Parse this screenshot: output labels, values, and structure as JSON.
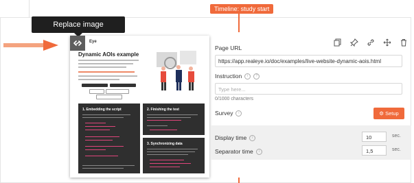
{
  "timeline_badge": "Timeline: study start",
  "replace_tooltip": "Replace image",
  "thumbnail": {
    "brand": "Eye",
    "title": "Dynamic AOIs example",
    "section1": "1. Embedding the script",
    "section2": "2. Finishing the test",
    "section3": "3. Synchronizing data"
  },
  "form": {
    "page_url_label": "Page URL",
    "page_url_value": "https://app.realeye.io/doc/examples/live-website-dynamic-aois.html",
    "instruction_label": "Instruction",
    "instruction_placeholder": "Type here...",
    "char_counter": "0/1000 characters",
    "survey_label": "Survey",
    "setup_button": "Setup",
    "display_time_label": "Display time",
    "display_time_value": "10",
    "display_time_unit": "sec.",
    "separator_time_label": "Separator time",
    "separator_time_value": "1,5",
    "separator_time_unit": "sec."
  },
  "colors": {
    "accent": "#f06a3b",
    "dark": "#2f2f2f"
  },
  "icons": [
    "copy-icon",
    "pin-icon",
    "link-icon",
    "move-icon",
    "trash-icon",
    "replace-image-icon",
    "info-icon",
    "gear-icon"
  ]
}
